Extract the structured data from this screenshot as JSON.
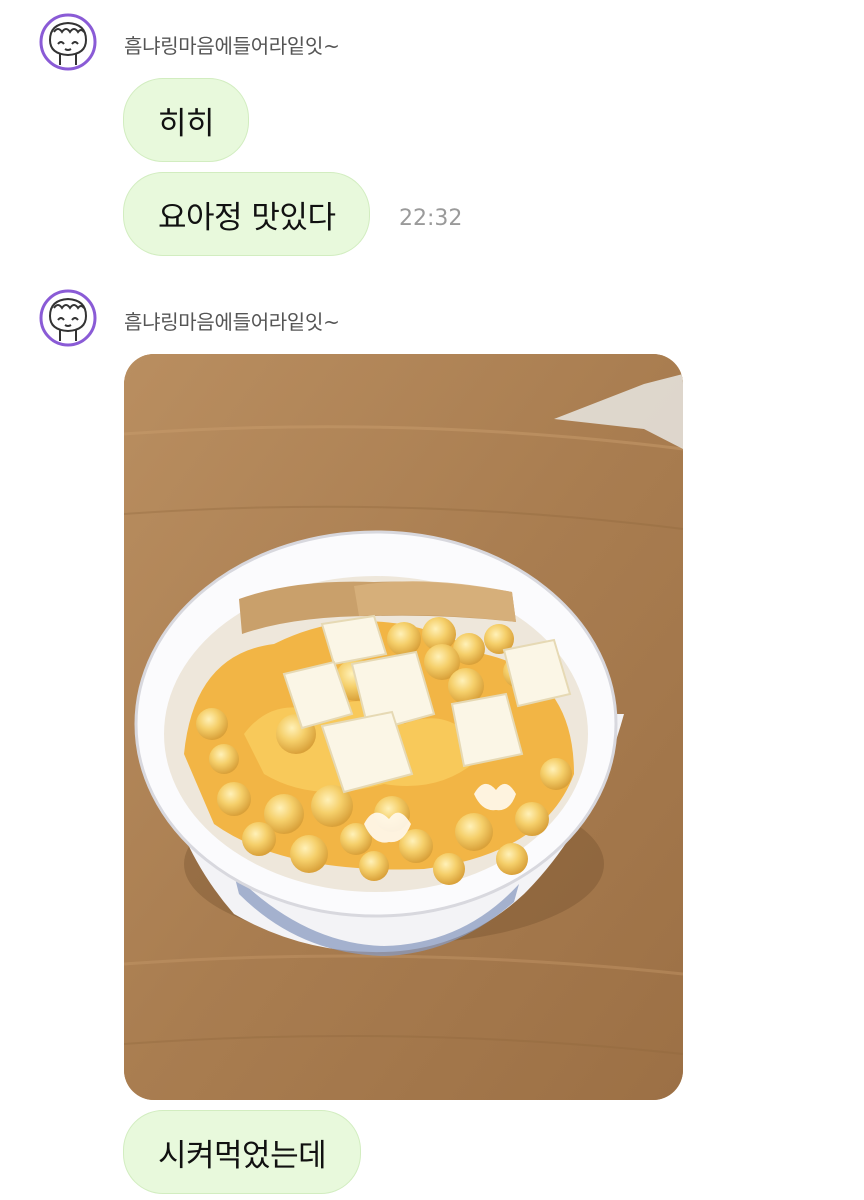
{
  "colors": {
    "bubble_bg": "#e8f9dc",
    "bubble_border": "#d2edc0",
    "avatar_stroke": "#8a5bd6",
    "sender_text": "#555555",
    "time_text": "#9a9a9a"
  },
  "messages": [
    {
      "sender": "흠냐링마음에들어라잍잇~",
      "avatar_icon": "cartoon-face-icon",
      "bubbles": [
        "히히",
        "요아정 맛있다"
      ],
      "time": "22:32"
    },
    {
      "sender": "흠냐링마음에들어라잍잇~",
      "avatar_icon": "cartoon-face-icon",
      "photo_icon": "yogurt-ice-cream-photo",
      "bubbles": [
        "시켜먹었는데"
      ]
    }
  ]
}
